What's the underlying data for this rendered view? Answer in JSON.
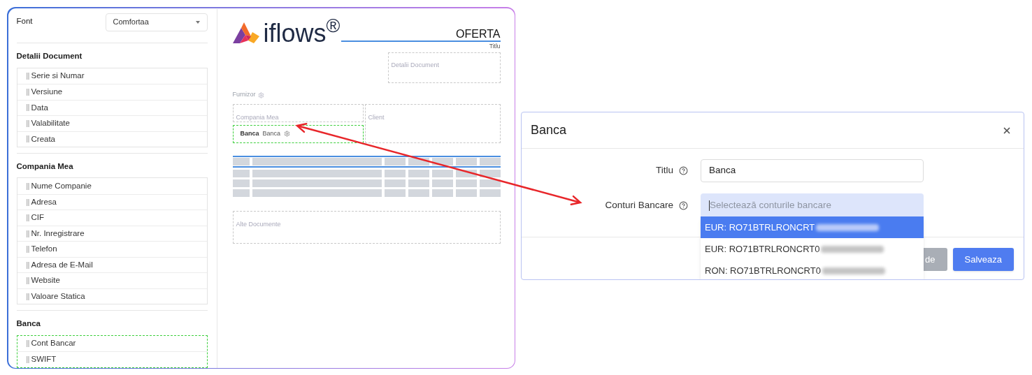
{
  "sidebar": {
    "font": {
      "label": "Font",
      "value": "Comfortaa"
    },
    "groups": [
      {
        "title": "Detalii Document",
        "highlighted": false,
        "items": [
          "Serie si Numar",
          "Versiune",
          "Data",
          "Valabilitate",
          "Creata"
        ]
      },
      {
        "title": "Compania Mea",
        "highlighted": false,
        "items": [
          "Nume Companie",
          "Adresa",
          "CIF",
          "Nr. Inregistrare",
          "Telefon",
          "Adresa de E-Mail",
          "Website",
          "Valoare Statica"
        ]
      },
      {
        "title": "Banca",
        "highlighted": true,
        "items": [
          "Cont Bancar",
          "SWIFT"
        ]
      }
    ]
  },
  "document": {
    "logo": "iflows$^{®}$",
    "title": "OFERTA",
    "title_caption": "Titlu",
    "details": "Detalii Document",
    "supplier_label": "Furnizor",
    "supplier": "Compania Mea",
    "client": "Client",
    "bank_block": {
      "label": "Banca",
      "value": "Banca",
      "highlighted": true
    },
    "other": "Alte Documente"
  },
  "dialog": {
    "title": "Banca",
    "fields": [
      {
        "kind": "input",
        "label": "Titlu",
        "value": "Banca"
      },
      {
        "kind": "select",
        "label": "Conturi Bancare",
        "placeholder": "Selectează conturile bancare",
        "focused": true
      }
    ],
    "options": [
      {
        "label": "EUR: RO71BTRLRONCRT",
        "selected": true,
        "redacted": true
      },
      {
        "label": "EUR: RO71BTRLRONCRT0",
        "selected": false,
        "redacted": true
      },
      {
        "label": "RON: RO71BTRLRONCRT0",
        "selected": false,
        "redacted": true
      }
    ],
    "buttons": [
      {
        "label": "de",
        "kind": "secondary"
      },
      {
        "label": "Salveaza",
        "kind": "primary"
      }
    ]
  }
}
